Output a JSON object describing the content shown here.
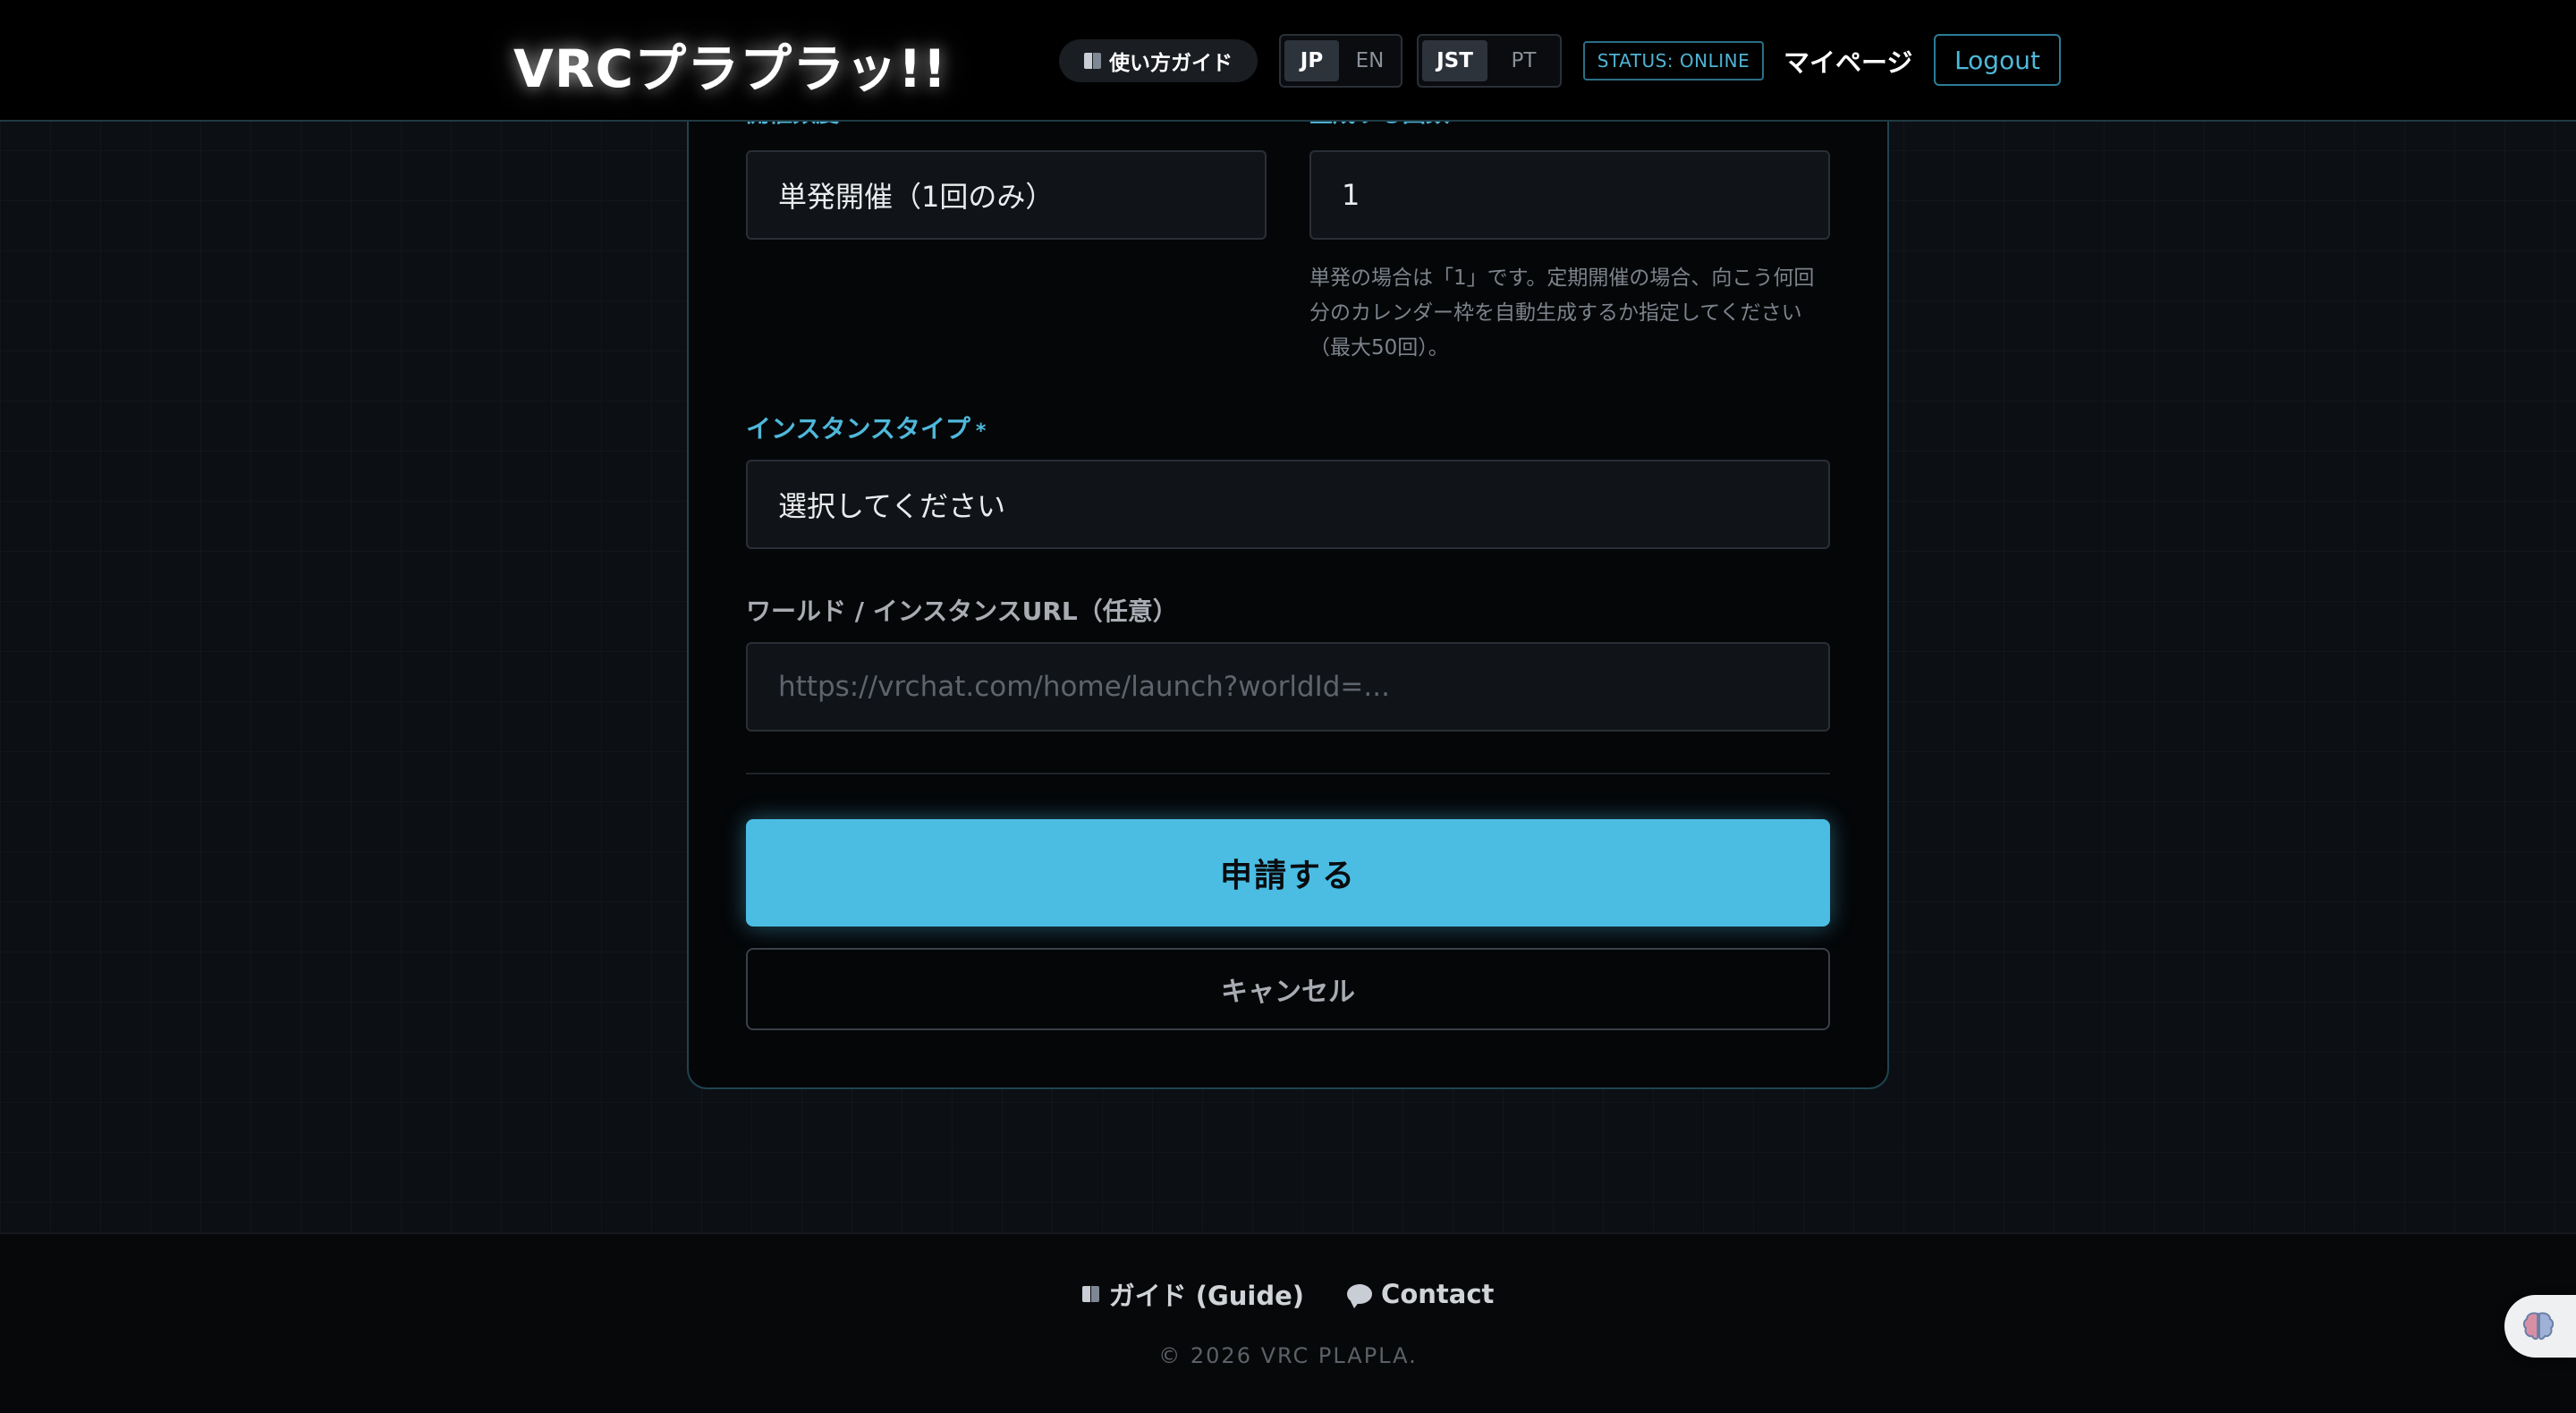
{
  "header": {
    "logo": "VRCプラプラッ!!",
    "guide_label": "使い方ガイド",
    "lang_options": [
      "JP",
      "EN"
    ],
    "lang_selected": "JP",
    "tz_options": [
      "JST",
      "PT"
    ],
    "tz_selected": "JST",
    "status": "STATUS: ONLINE",
    "mypage": "マイページ",
    "logout": "Logout"
  },
  "form": {
    "frequency_label": "開催頻度",
    "frequency_value": "単発開催（1回のみ）",
    "count_label": "生成する回数",
    "count_value": "1",
    "count_hint": "単発の場合は「1」です。定期開催の場合、向こう何回分のカレンダー枠を自動生成するか指定してください（最大50回）。",
    "instance_type_label": "インスタンスタイプ",
    "instance_type_required": "*",
    "instance_type_placeholder": "選択してください",
    "url_label": "ワールド / インスタンスURL（任意）",
    "url_placeholder": "https://vrchat.com/home/launch?worldId=...",
    "submit": "申請する",
    "cancel": "キャンセル"
  },
  "footer": {
    "guide_link": "ガイド (Guide)",
    "contact_link": "Contact",
    "copyright": "© 2026 VRC PLAPLA."
  },
  "colors": {
    "accent": "#4bbde3",
    "background": "#0c0f13",
    "status": "#4fb3d4"
  }
}
